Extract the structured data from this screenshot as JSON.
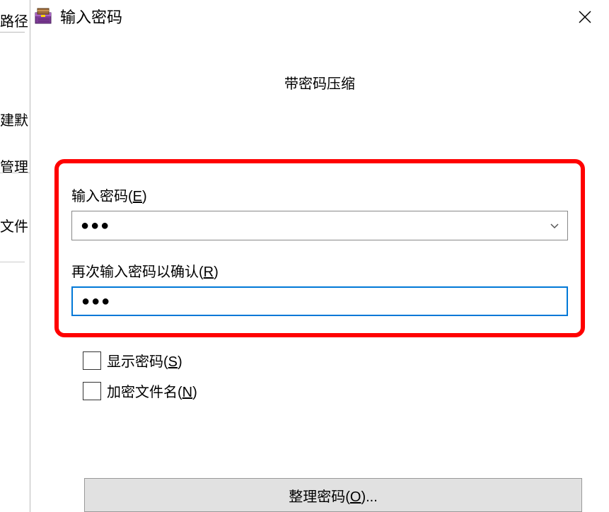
{
  "background": {
    "label1": "路径",
    "label2": "建默",
    "label3": "管理",
    "label4": "文件"
  },
  "dialog": {
    "title": "输入密码",
    "subtitle": "带密码压缩",
    "password_label_prefix": "输入密码(",
    "password_label_key": "E",
    "password_label_suffix": ")",
    "password_value": "●●●",
    "confirm_label_prefix": "再次输入密码以确认(",
    "confirm_label_key": "R",
    "confirm_label_suffix": ")",
    "confirm_value": "●●●",
    "show_password_prefix": "显示密码(",
    "show_password_key": "S",
    "show_password_suffix": ")",
    "encrypt_names_prefix": "加密文件名(",
    "encrypt_names_key": "N",
    "encrypt_names_suffix": ")",
    "organize_prefix": "整理密码(",
    "organize_key": "O",
    "organize_suffix": ")..."
  }
}
